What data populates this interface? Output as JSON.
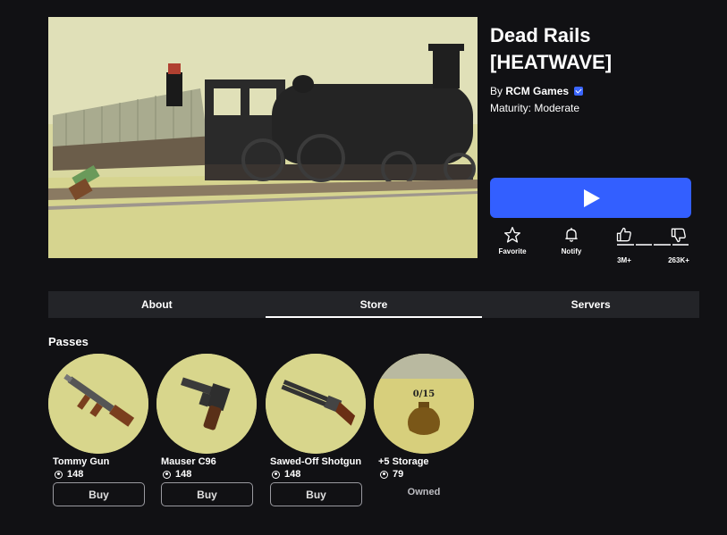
{
  "game": {
    "title": "Dead Rails [HEATWAVE]",
    "by_prefix": "By",
    "creator": "RCM Games",
    "maturity": "Maturity: Moderate"
  },
  "actions": {
    "favorite": "Favorite",
    "notify": "Notify",
    "likes": "3M+",
    "dislikes": "263K+",
    "like_ratio": 0.92
  },
  "tabs": [
    {
      "label": "About",
      "active": false
    },
    {
      "label": "Store",
      "active": true
    },
    {
      "label": "Servers",
      "active": false
    }
  ],
  "passes_section": {
    "title": "Passes",
    "items": [
      {
        "name": "Tommy Gun",
        "price": "148",
        "action": "Buy",
        "icon": "tommy-gun-icon"
      },
      {
        "name": "Mauser C96",
        "price": "148",
        "action": "Buy",
        "icon": "mauser-pistol-icon"
      },
      {
        "name": "Sawed-Off Shotgun",
        "price": "148",
        "action": "Buy",
        "icon": "shotgun-icon"
      },
      {
        "name": "+5 Storage",
        "price": "79",
        "action": "Owned",
        "icon": "storage-bag-icon",
        "bag_label": "0/15"
      }
    ]
  },
  "colors": {
    "background": "#111114",
    "play_button": "#335fff",
    "tab_bar": "#232428",
    "verified": "#3b66ff"
  }
}
